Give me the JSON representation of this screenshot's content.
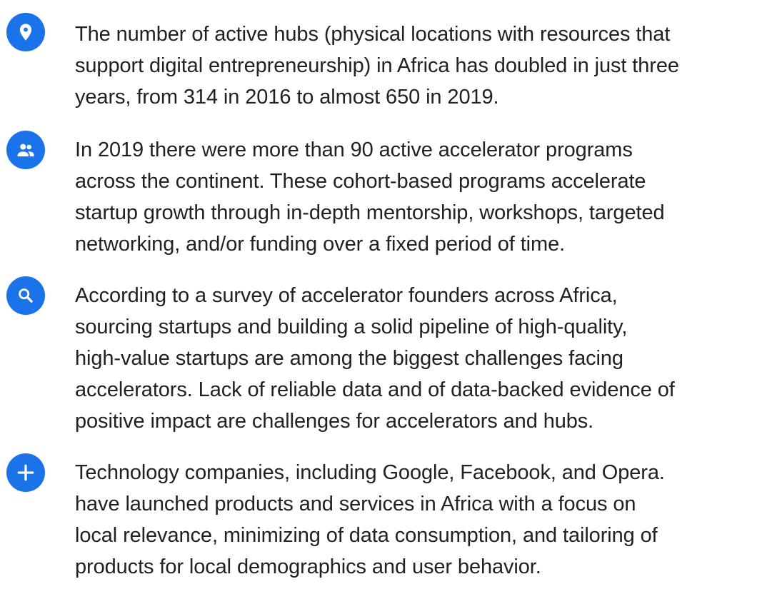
{
  "icon_color": "#1a73e8",
  "items": [
    {
      "icon": "location-pin-icon",
      "lines": [
        "The number of active hubs (physical locations with resources that",
        "support digital entrepreneurship) in Africa has doubled in just three",
        "years, from 314 in 2016 to almost 650 in 2019."
      ]
    },
    {
      "icon": "people-icon",
      "lines": [
        "In 2019 there were more than 90 active accelerator programs",
        "across the continent. These cohort-based programs accelerate",
        "startup growth through in-depth mentorship, workshops, targeted",
        "networking, and/or funding over a fixed period of time."
      ]
    },
    {
      "icon": "search-icon",
      "lines": [
        "According to a survey of accelerator founders across Africa,",
        "sourcing startups and building a solid pipeline of high-quality,",
        "high-value startups are among the biggest challenges facing",
        "accelerators.  Lack of reliable data and of data-backed evidence of",
        "positive impact are challenges for accelerators and hubs."
      ]
    },
    {
      "icon": "plus-icon",
      "lines": [
        "Technology companies, including Google, Facebook, and Opera.",
        "have launched products and services in Africa with a focus on",
        "local relevance, minimizing of data consumption, and tailoring of",
        "products for local demographics and user behavior."
      ]
    }
  ]
}
